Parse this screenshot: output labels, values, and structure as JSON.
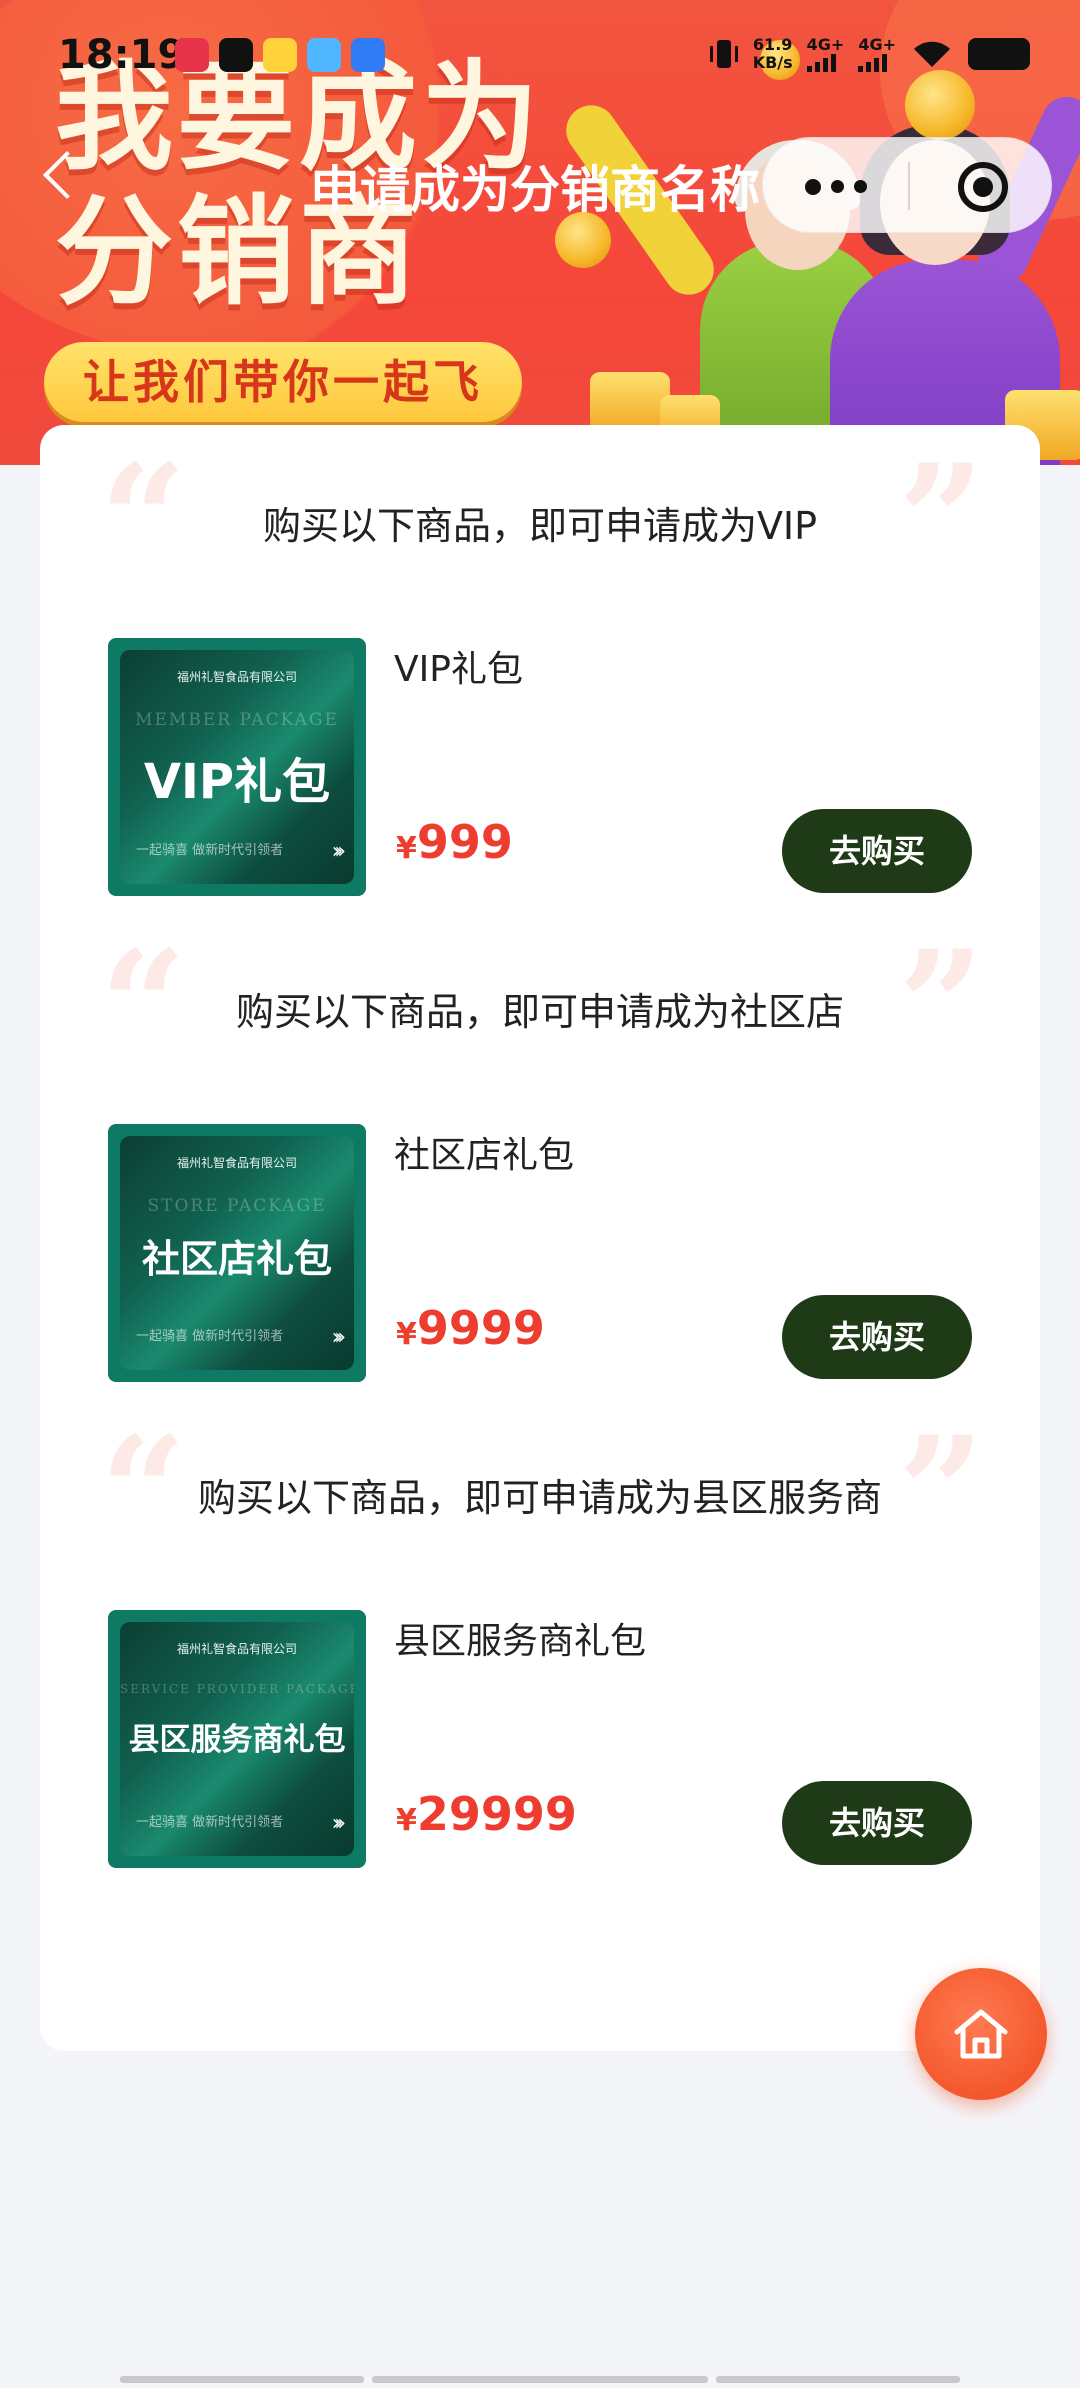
{
  "status_bar": {
    "time": "18:19",
    "net_speed": "61.9",
    "net_unit": "KB/s",
    "net1": "4G+",
    "net2": "4G+"
  },
  "banner": {
    "headline_line1": "我要成为",
    "headline_line2": "分销商",
    "tagline": "让我们带你一起飞"
  },
  "nav": {
    "title": "申请成为分销商名称"
  },
  "sections": [
    {
      "title": "购买以下商品，即可申请成为VIP",
      "product_name": "VIP礼包",
      "thumb_company": "福州礼智食品有限公司",
      "thumb_en": "MEMBER PACKAGE",
      "thumb_title": "VIP礼包",
      "thumb_slogan": "一起骑喜 做新时代引领者",
      "currency": "¥",
      "price": "999",
      "buy_label": "去购买"
    },
    {
      "title": "购买以下商品，即可申请成为社区店",
      "product_name": "社区店礼包",
      "thumb_company": "福州礼智食品有限公司",
      "thumb_en": "STORE PACKAGE",
      "thumb_title": "社区店礼包",
      "thumb_slogan": "一起骑喜 做新时代引领者",
      "currency": "¥",
      "price": "9999",
      "buy_label": "去购买"
    },
    {
      "title": "购买以下商品，即可申请成为县区服务商",
      "product_name": "县区服务商礼包",
      "thumb_company": "福州礼智食品有限公司",
      "thumb_en": "SERVICE PROVIDER PACKAGE",
      "thumb_title": "县区服务商礼包",
      "thumb_slogan": "一起骑喜 做新时代引领者",
      "currency": "¥",
      "price": "29999",
      "buy_label": "去购买"
    }
  ],
  "icons": {
    "back": "chevron-left-icon",
    "more": "more-dots-icon",
    "close_miniapp": "target-icon",
    "home": "home-icon"
  },
  "colors": {
    "banner_red": "#f5473a",
    "price_red": "#ee3d2e",
    "buy_button": "#1e3a17",
    "home_button": "#f4582c"
  }
}
